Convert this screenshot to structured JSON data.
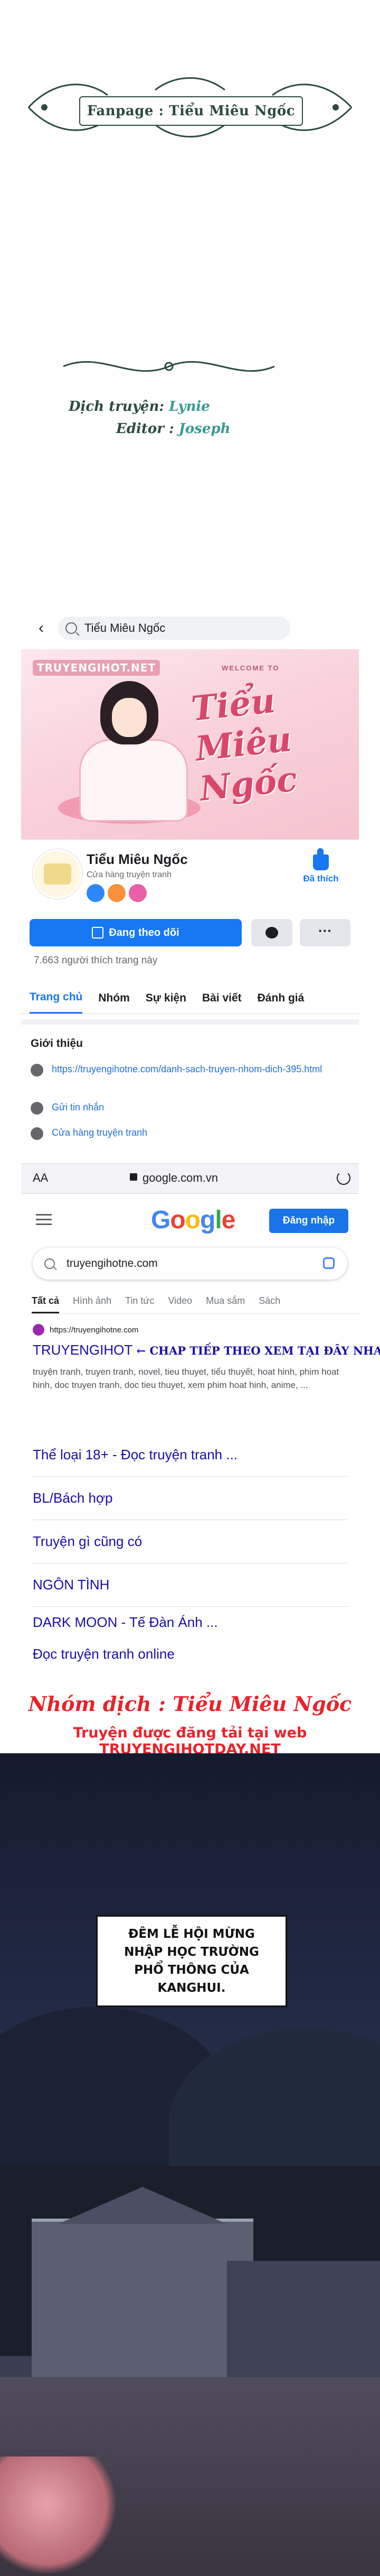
{
  "banner": {
    "text": "Fanpage : Tiểu Miêu Ngốc"
  },
  "credits": {
    "translator_label": "Dịch truyện:",
    "translator_value": "Lynie",
    "editor_label": "Editor :",
    "editor_value": "Joseph"
  },
  "facebook": {
    "search_text": "Tiểu Miêu Ngốc",
    "cover_watermark": "TRUYENGIHOT.NET",
    "cover_welcome": "WELCOME TO",
    "cover_script": "Tiểu Miêu Ngốc",
    "page_name": "Tiểu Miêu Ngốc",
    "category": "Cửa hàng truyện tranh",
    "liked_label": "Đã thích",
    "follow_label": "Đang theo dõi",
    "more_label": "···",
    "likes_count": "7.663 người thích trang này",
    "tabs": [
      "Trang chủ",
      "Nhóm",
      "Sự kiện",
      "Bài viết",
      "Đánh giá"
    ],
    "intro_title": "Giới thiệu",
    "intro_link": "https://truyengihotne.com/danh-sach-truyen-nhom-dich-395.html",
    "intro_message": "Gửi tin nhắn",
    "intro_shop": "Cửa hàng truyện tranh"
  },
  "browser": {
    "aa": "AA",
    "url": "google.com.vn"
  },
  "google": {
    "logo": "Google",
    "signin": "Đăng nhập",
    "query": "truyengihotne.com",
    "tabs": [
      "Tất cả",
      "Hình ảnh",
      "Tin tức",
      "Video",
      "Mua sắm",
      "Sách"
    ],
    "result_site": "https://truyengihotne.com",
    "result_title_brand": "TRUYENGIHOT",
    "result_title_extra": " ← CHAP TIẾP THEO XEM TẠI ĐÂY NHA",
    "result_snippet": "truyện tranh, truyen tranh, novel, tieu thuyet, tiểu thuyết, hoat hinh, phim hoat hinh, doc truyen tranh, doc tieu thuyet, xem phim hoat hinh, anime, ...",
    "sitelinks": [
      "Thể loại 18+ - Đọc truyện tranh ...",
      "BL/Bách hợp",
      "Truyện gì cũng có",
      "NGÔN TÌNH",
      "DARK MOON - Tế Đàn Ánh ...",
      "Đọc truyện tranh online"
    ]
  },
  "footer": {
    "group_line": "Nhóm dịch : Tiểu Miêu Ngốc",
    "site_line": "Truyện được đăng tải tại web TRUYENGIHOTDAY.NET"
  },
  "comic": {
    "caption": "ĐÊM LỄ HỘI MỪNG NHẬP HỌC TRƯỜNG PHỔ THÔNG CỦA KANGHUI."
  },
  "colors": {
    "facebook_blue": "#1877f2",
    "google_link": "#1a0dab",
    "banner_green": "#2c4a42",
    "accent_red": "#e8232a"
  }
}
